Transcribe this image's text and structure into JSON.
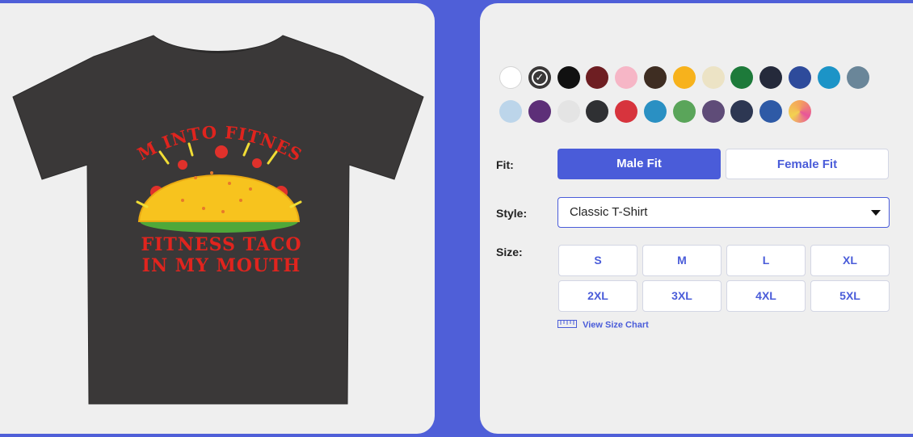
{
  "product": {
    "design_lines": [
      "I'M INTO FITNESS",
      "FITNESS TACO",
      "IN MY MOUTH"
    ]
  },
  "colors": {
    "swatches": [
      {
        "name": "white",
        "hex": "#ffffff"
      },
      {
        "name": "charcoal-selected",
        "hex": "#3a3838",
        "selected": true
      },
      {
        "name": "black",
        "hex": "#111111"
      },
      {
        "name": "maroon",
        "hex": "#6e1e22"
      },
      {
        "name": "light-pink",
        "hex": "#f6b6c6"
      },
      {
        "name": "dark-brown",
        "hex": "#3e2d22"
      },
      {
        "name": "gold",
        "hex": "#f7b21c"
      },
      {
        "name": "cream",
        "hex": "#ece3c5"
      },
      {
        "name": "kelly-green",
        "hex": "#1d7a3a"
      },
      {
        "name": "dark-navy",
        "hex": "#252a3b"
      },
      {
        "name": "royal-heather",
        "hex": "#2e4b9b"
      },
      {
        "name": "turquoise",
        "hex": "#1c94c7"
      },
      {
        "name": "slate",
        "hex": "#6a8699"
      },
      {
        "name": "light-blue",
        "hex": "#bcd5ea"
      },
      {
        "name": "purple",
        "hex": "#5d2f78"
      },
      {
        "name": "heather-white",
        "hex": "#e4e4e4"
      },
      {
        "name": "charcoal",
        "hex": "#2f3033"
      },
      {
        "name": "red",
        "hex": "#d7343d"
      },
      {
        "name": "sky-blue",
        "hex": "#2a90c3"
      },
      {
        "name": "green",
        "hex": "#5aa55a"
      },
      {
        "name": "heather-purple",
        "hex": "#5f4c78"
      },
      {
        "name": "heather-navy",
        "hex": "#2d3752"
      },
      {
        "name": "heather-royal",
        "hex": "#2e5aa6"
      },
      {
        "name": "tie-dye",
        "hex": "#f4a25c"
      }
    ],
    "selected_check": "✓",
    "accent": "#4a5cd9"
  },
  "fit": {
    "label": "Fit:",
    "options": [
      "Male Fit",
      "Female Fit"
    ],
    "selected": "Male Fit"
  },
  "style": {
    "label": "Style:",
    "value": "Classic T-Shirt"
  },
  "size": {
    "label": "Size:",
    "options": [
      "S",
      "M",
      "L",
      "XL",
      "2XL",
      "3XL",
      "4XL",
      "5XL"
    ],
    "chart_link": "View Size Chart"
  }
}
